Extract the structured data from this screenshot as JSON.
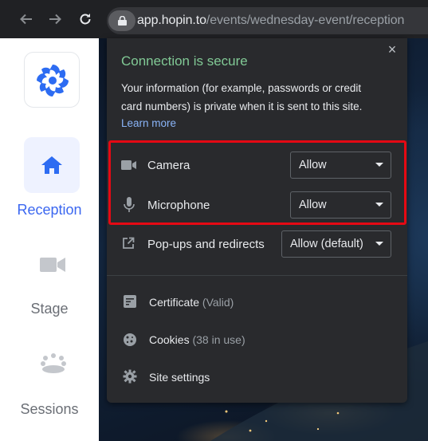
{
  "browser": {
    "url_host": "app.hopin.to",
    "url_path": "/events/wednesday-event/reception",
    "icons": [
      "back-arrow-icon",
      "forward-arrow-icon",
      "reload-icon",
      "lock-icon"
    ]
  },
  "sidebar": {
    "items": [
      {
        "label": "Reception",
        "icon": "home-icon",
        "active": true
      },
      {
        "label": "Stage",
        "icon": "video-camera-icon",
        "active": false
      },
      {
        "label": "Sessions",
        "icon": "people-group-icon",
        "active": false
      }
    ]
  },
  "popup": {
    "title": "Connection is secure",
    "description": "Your information (for example, passwords or credit card numbers) is private when it is sent to this site.",
    "learn_more": "Learn more",
    "close": "×",
    "permissions": [
      {
        "label": "Camera",
        "value": "Allow",
        "icon": "camera-icon"
      },
      {
        "label": "Microphone",
        "value": "Allow",
        "icon": "microphone-icon"
      },
      {
        "label": "Pop-ups and redirects",
        "value": "Allow (default)",
        "icon": "popup-icon"
      }
    ],
    "links": [
      {
        "label": "Certificate",
        "detail": "(Valid)",
        "icon": "certificate-icon"
      },
      {
        "label": "Cookies",
        "detail": "(38 in use)",
        "icon": "cookie-icon"
      },
      {
        "label": "Site settings",
        "detail": "",
        "icon": "gear-icon"
      }
    ]
  },
  "colors": {
    "secure_green": "#81c995",
    "link_blue": "#8ab4f8",
    "highlight_red": "#e50914",
    "hopin_blue": "#3b67f0"
  }
}
